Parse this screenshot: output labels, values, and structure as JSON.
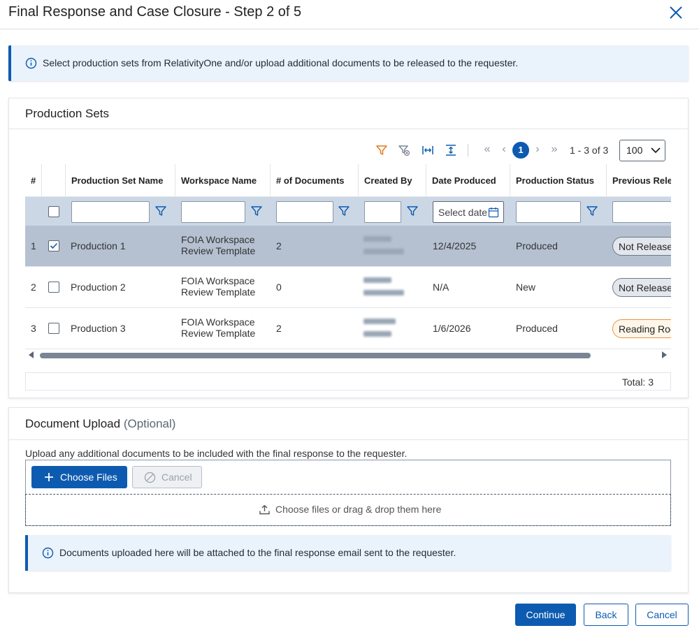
{
  "dialog": {
    "title": "Final Response and Case Closure - Step 2 of 5"
  },
  "info_banner": {
    "text": "Select production sets from RelativityOne and/or upload additional documents to be released to the requester."
  },
  "production_sets": {
    "title": "Production Sets",
    "pagination": {
      "current_page": "1",
      "range": "1 - 3 of 3",
      "page_size": "100"
    },
    "columns": [
      "#",
      "Production Set Name",
      "Workspace Name",
      "# of Documents",
      "Created By",
      "Date Produced",
      "Production Status",
      "Previous Release"
    ],
    "date_filter_placeholder": "Select date",
    "rows": [
      {
        "num": "1",
        "name": "Production 1",
        "workspace_line1": "FOIA Workspace",
        "workspace_line2": "Review Template",
        "documents": "2",
        "date_produced": "12/4/2025",
        "status": "Produced",
        "previous_release": "Not Released",
        "checked": true
      },
      {
        "num": "2",
        "name": "Production 2",
        "workspace_line1": "FOIA Workspace",
        "workspace_line2": "Review Template",
        "documents": "0",
        "date_produced": "N/A",
        "status": "New",
        "previous_release": "Not Released",
        "checked": false
      },
      {
        "num": "3",
        "name": "Production 3",
        "workspace_line1": "FOIA Workspace",
        "workspace_line2": "Review Template",
        "documents": "2",
        "date_produced": "1/6/2026",
        "status": "Produced",
        "previous_release": "Reading Room",
        "checked": false
      }
    ],
    "total": "Total: 3"
  },
  "document_upload": {
    "title": "Document Upload",
    "optional": "(Optional)",
    "description": "Upload any additional documents to be included with the final response to the requester.",
    "choose_files": "Choose Files",
    "cancel": "Cancel",
    "drop_text": "Choose files or drag & drop them here",
    "note": "Documents uploaded here will be attached to the final response email sent to the requester."
  },
  "footer": {
    "continue": "Continue",
    "back": "Back",
    "cancel": "Cancel"
  },
  "colors": {
    "primary": "#0d5bb0",
    "selected_row": "#b5c1d1",
    "filter_row": "#cbd7e5",
    "banner_bg": "#eaf2fb",
    "filter_active": "#e07b1e"
  }
}
